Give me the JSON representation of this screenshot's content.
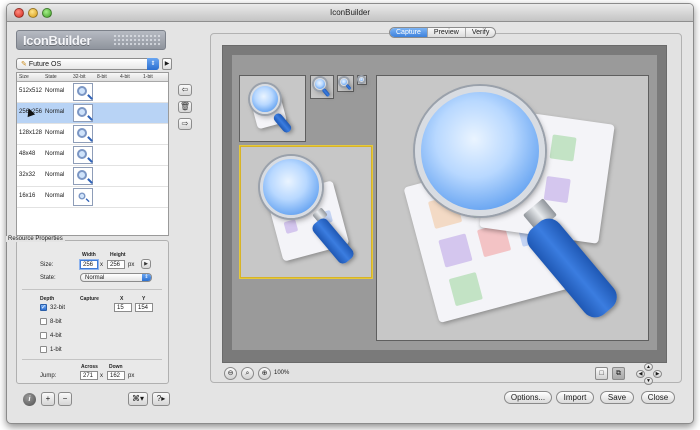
{
  "window": {
    "title": "IconBuilder"
  },
  "logo": {
    "text": "IconBuilder"
  },
  "platform": {
    "selected": "Future OS"
  },
  "table": {
    "headers": [
      "Size",
      "State",
      "32-bit",
      "8-bit",
      "4-bit",
      "1-bit"
    ],
    "rows": [
      {
        "size": "512x512",
        "state": "Normal"
      },
      {
        "size": "256x256",
        "state": "Normal"
      },
      {
        "size": "128x128",
        "state": "Normal"
      },
      {
        "size": "48x48",
        "state": "Normal"
      },
      {
        "size": "32x32",
        "state": "Normal"
      },
      {
        "size": "16x16",
        "state": "Normal"
      }
    ],
    "selected_index": 1
  },
  "resource": {
    "title": "Resource Properties",
    "size_label": "Size:",
    "width_label": "Width",
    "height_label": "Height",
    "width": "256",
    "height": "256",
    "times": "x",
    "px": "px",
    "state_label": "State:",
    "state_value": "Normal",
    "depth_label": "Depth",
    "capture_label": "Capture",
    "x_label": "X",
    "y_label": "Y",
    "depths": [
      "32-bit",
      "8-bit",
      "4-bit",
      "1-bit"
    ],
    "capture_x": "15",
    "capture_y": "154",
    "jump_label": "Jump:",
    "across_label": "Across",
    "down_label": "Down",
    "jump_across": "271",
    "jump_down": "162"
  },
  "tabs": [
    "Capture",
    "Preview",
    "Verify"
  ],
  "zoom": {
    "level": "100%"
  },
  "buttons": {
    "options": "Options...",
    "import": "Import",
    "save": "Save",
    "close": "Close"
  },
  "colors": {
    "accent": "#3d81dc",
    "selection": "#b8d3f5",
    "canvas": "#7a7a7a",
    "highlight": "#e5c93a"
  }
}
